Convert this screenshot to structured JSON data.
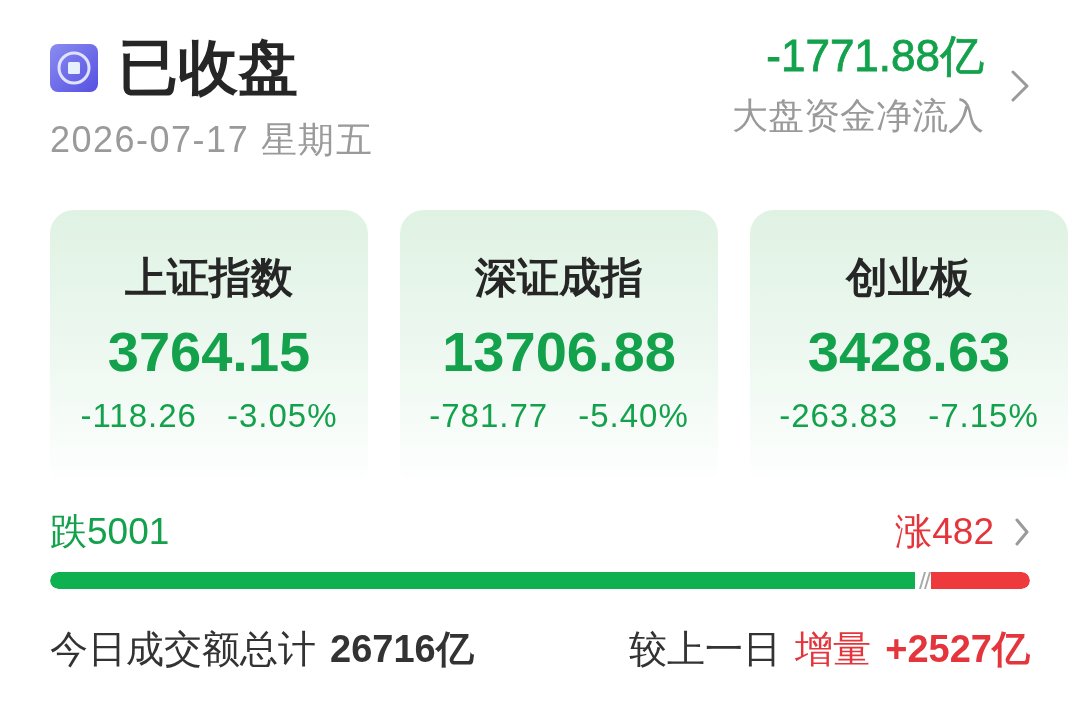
{
  "status": {
    "title": "已收盘",
    "date": "2026-07-17 星期五"
  },
  "net_flow": {
    "value": "-1771.88亿",
    "label": "大盘资金净流入",
    "kind": "fall"
  },
  "indices": [
    {
      "name": "上证指数",
      "value": "3764.15",
      "change": "-118.26",
      "percent": "-3.05%",
      "kind": "fall"
    },
    {
      "name": "深证成指",
      "value": "13706.88",
      "change": "-781.77",
      "percent": "-5.40%",
      "kind": "fall"
    },
    {
      "name": "创业板",
      "value": "3428.63",
      "change": "-263.83",
      "percent": "-7.15%",
      "kind": "fall"
    }
  ],
  "breadth": {
    "falling": "跌5001",
    "rising": "涨482",
    "level": 0.883
  },
  "turnover": {
    "label": "今日成交额总计",
    "value": "26716亿",
    "compare_label": "较上一日",
    "change_label": "增量",
    "change_value": "+2527亿",
    "kind": "rise"
  }
}
